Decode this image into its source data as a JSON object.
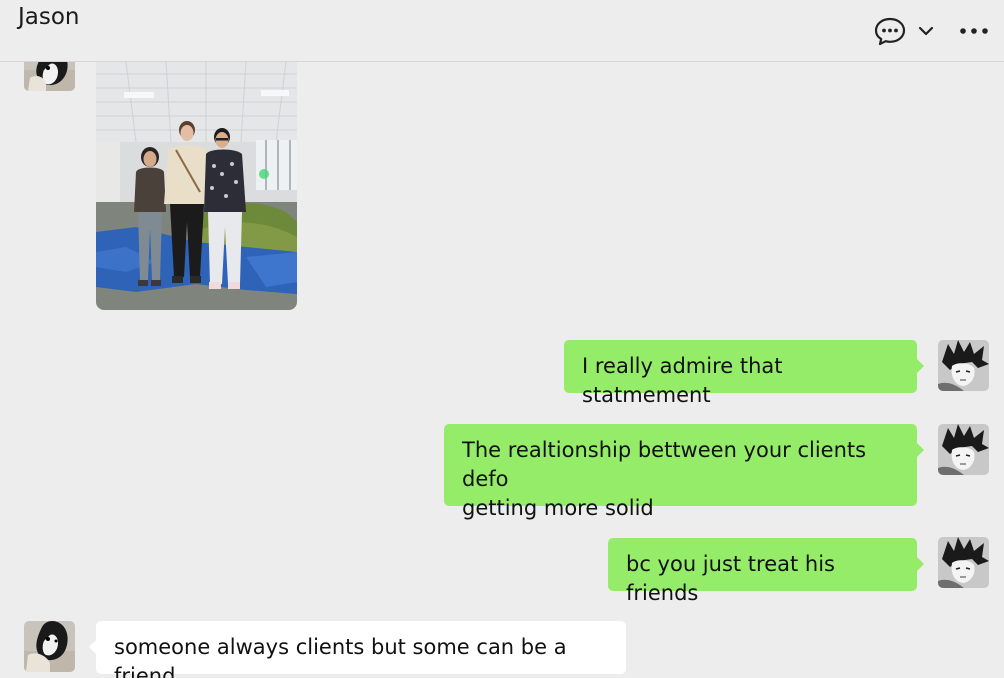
{
  "header": {
    "title": "Jason"
  },
  "messages": [
    {
      "id": "m1",
      "direction": "incoming",
      "kind": "image"
    },
    {
      "id": "m2",
      "direction": "outgoing",
      "text": "I really admire that statmement"
    },
    {
      "id": "m3",
      "direction": "outgoing",
      "lines": [
        "The realtionship bettween your clients defo",
        "getting more solid"
      ]
    },
    {
      "id": "m4",
      "direction": "outgoing",
      "text": "bc you just treat his friends"
    },
    {
      "id": "m5",
      "direction": "incoming",
      "text": "someone always clients but some can be a friend"
    }
  ],
  "colors": {
    "background": "#ededed",
    "outgoing_bubble": "#95ec69",
    "incoming_bubble": "#ffffff",
    "divider": "#d6d6d6"
  },
  "icons": {
    "chat": "chat-bubble-dots-icon",
    "dropdown": "chevron-down-icon",
    "more": "more-horizontal-icon"
  }
}
